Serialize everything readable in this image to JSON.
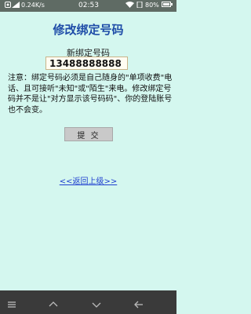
{
  "status_bar": {
    "net_speed": "0.24K/s",
    "time": "02:53",
    "battery": "80%"
  },
  "page": {
    "title": "修改绑定号码",
    "field_label": "新绑定号码",
    "phone_value": "13488888888",
    "notice": "注意：绑定号码必须是自己随身的\"单项收费\"电话、且可接听\"未知\"或\"陌生\"来电。修改绑定号码并不是让\"对方显示该号码码\"、你的登陆账号也不会变。",
    "submit_label": "提 交",
    "back_link": "<<返回上级>>"
  },
  "icons": {
    "status": [
      "notification-icon",
      "signal-icon",
      "wifi-icon",
      "silent-icon",
      "battery-icon"
    ],
    "navigation": [
      "menu-icon",
      "home-icon",
      "recent-apps-icon",
      "back-icon"
    ]
  },
  "colors": {
    "background": "#d4f7ef",
    "title": "#1f4da8",
    "link": "#1f3fcf",
    "status_bar": "#5f6b64",
    "nav_bar": "#3a3a3a"
  }
}
